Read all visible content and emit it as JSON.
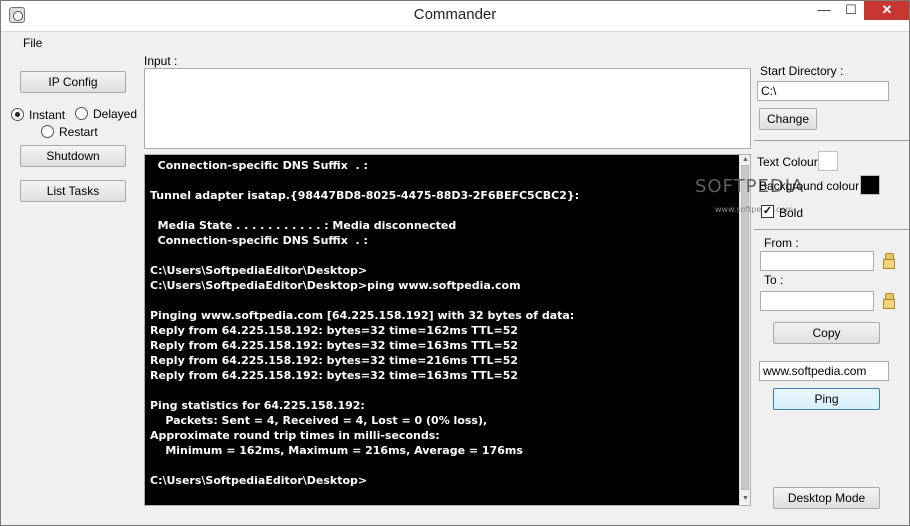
{
  "window": {
    "title": "Commander",
    "minimize_glyph": "—",
    "maximize_glyph": "☐",
    "close_glyph": "✕",
    "app_icon": "gear-app-icon"
  },
  "menu": {
    "file": "File"
  },
  "left_panel": {
    "ip_config": "IP Config",
    "radio_instant": "Instant",
    "radio_delayed": "Delayed",
    "radio_restart": "Restart",
    "selected_radio": "Instant",
    "shutdown": "Shutdown",
    "list_tasks": "List Tasks"
  },
  "input": {
    "label": "Input :",
    "value": ""
  },
  "console": {
    "text": "  Connection-specific DNS Suffix  . :\n\nTunnel adapter isatap.{98447BD8-8025-4475-88D3-2F6BEFC5CBC2}:\n\n  Media State . . . . . . . . . . . : Media disconnected\n  Connection-specific DNS Suffix  . :\n\nC:\\Users\\SoftpediaEditor\\Desktop>\nC:\\Users\\SoftpediaEditor\\Desktop>ping www.softpedia.com\n\nPinging www.softpedia.com [64.225.158.192] with 32 bytes of data:\nReply from 64.225.158.192: bytes=32 time=162ms TTL=52\nReply from 64.225.158.192: bytes=32 time=163ms TTL=52\nReply from 64.225.158.192: bytes=32 time=216ms TTL=52\nReply from 64.225.158.192: bytes=32 time=163ms TTL=52\n\nPing statistics for 64.225.158.192:\n    Packets: Sent = 4, Received = 4, Lost = 0 (0% loss),\nApproximate round trip times in milli-seconds:\n    Minimum = 162ms, Maximum = 216ms, Average = 176ms\n\nC:\\Users\\SoftpediaEditor\\Desktop>",
    "background_color": "#000000",
    "text_color": "#ffffff"
  },
  "right_panel": {
    "start_directory_label": "Start Directory :",
    "start_directory_value": "C:\\",
    "change": "Change",
    "text_colour_label": "Text Colour",
    "text_colour": "#ffffff",
    "background_colour_label": "Background colour",
    "background_colour": "#000000",
    "bold_label": "Bold",
    "bold_checked": true,
    "from_label": "From :",
    "from_value": "",
    "to_label": "To :",
    "to_value": "",
    "copy": "Copy",
    "ping_host": "www.softpedia.com",
    "ping": "Ping",
    "desktop_mode": "Desktop Mode"
  },
  "watermark": {
    "text": "SOFTPEDIA",
    "sub": "www.softpedia.com"
  }
}
